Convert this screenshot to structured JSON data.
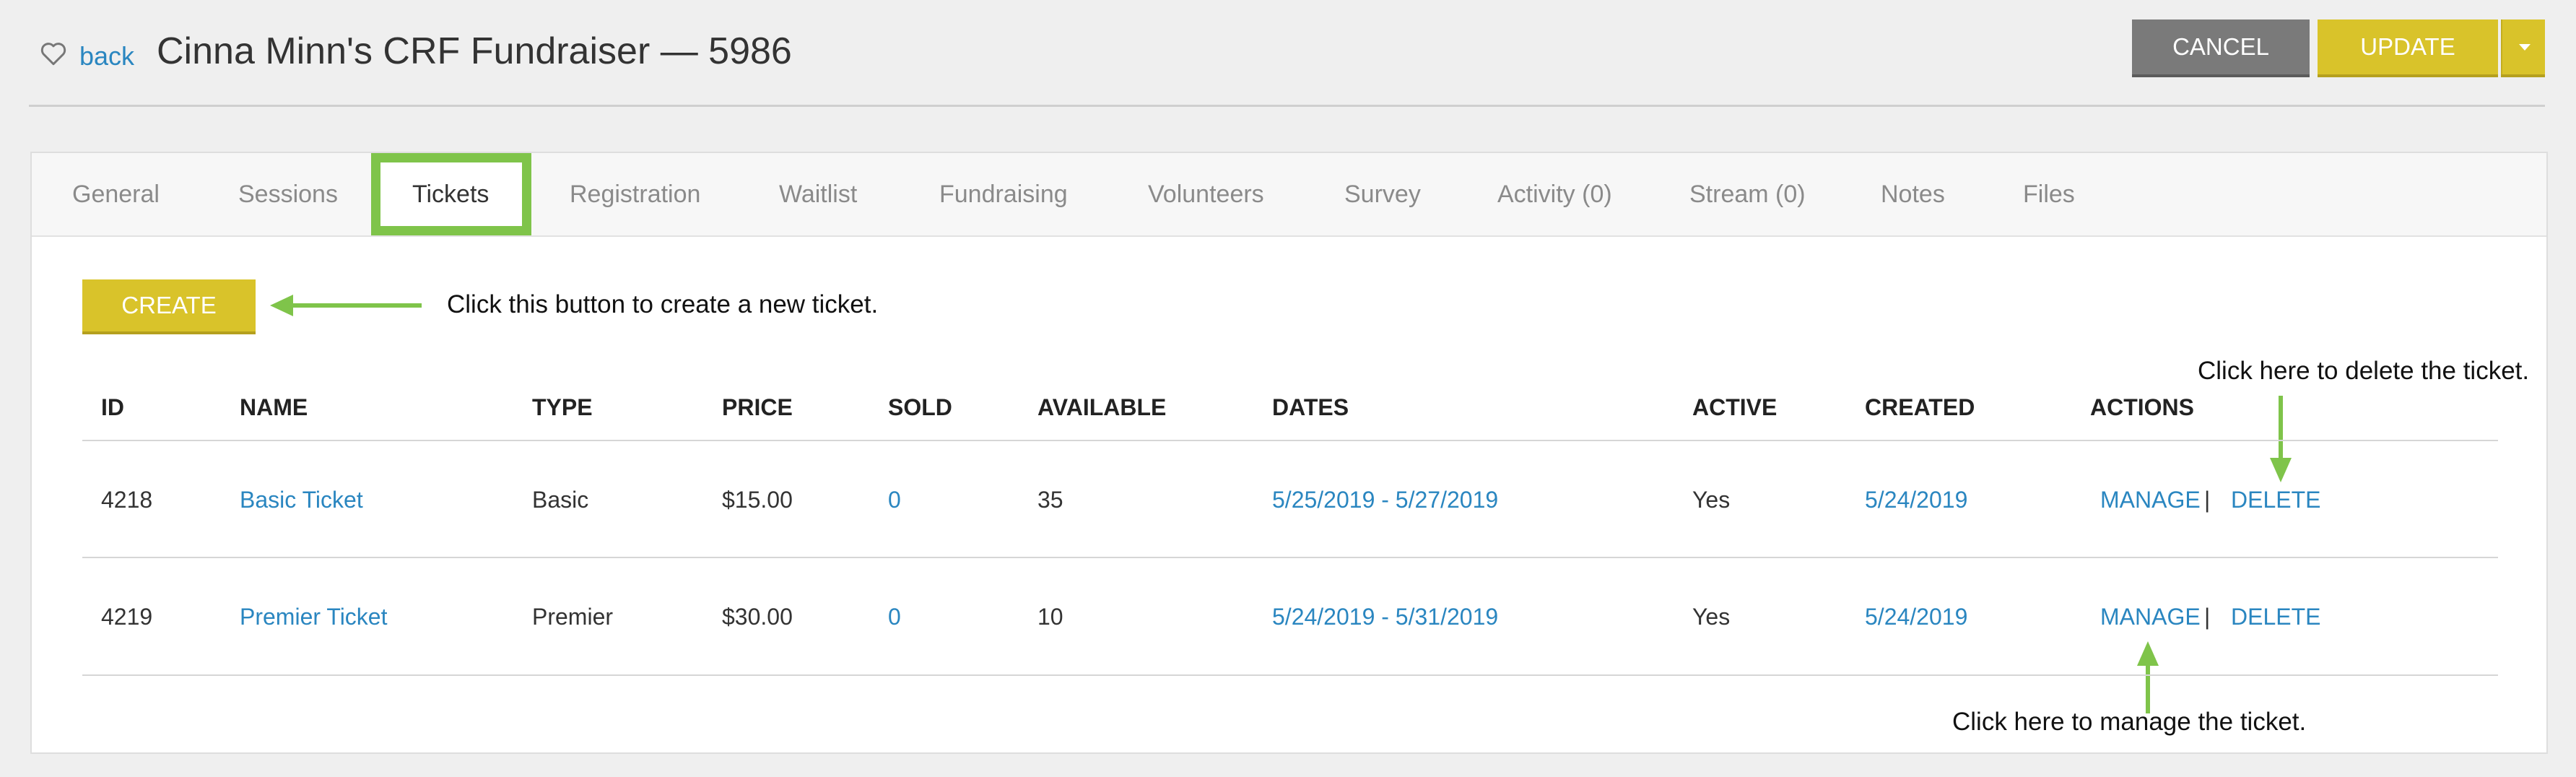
{
  "header": {
    "back_label": "back",
    "title": "Cinna Minn's CRF Fundraiser — 5986",
    "cancel_label": "CANCEL",
    "update_label": "UPDATE"
  },
  "tabs": [
    {
      "label": "General"
    },
    {
      "label": "Sessions"
    },
    {
      "label": "Tickets",
      "active": true
    },
    {
      "label": "Registration"
    },
    {
      "label": "Waitlist"
    },
    {
      "label": "Fundraising"
    },
    {
      "label": "Volunteers"
    },
    {
      "label": "Survey"
    },
    {
      "label": "Activity (0)"
    },
    {
      "label": "Stream (0)"
    },
    {
      "label": "Notes"
    },
    {
      "label": "Files"
    }
  ],
  "create_label": "CREATE",
  "annotations": {
    "create": "Click this button to create a new ticket.",
    "delete": "Click here to delete the ticket.",
    "manage": "Click here to manage the ticket."
  },
  "table": {
    "columns": [
      "ID",
      "NAME",
      "TYPE",
      "PRICE",
      "SOLD",
      "AVAILABLE",
      "DATES",
      "ACTIVE",
      "CREATED",
      "ACTIONS"
    ],
    "rows": [
      {
        "id": "4218",
        "name": "Basic Ticket",
        "type": "Basic",
        "price": "$15.00",
        "sold": "0",
        "available": "35",
        "dates": "5/25/2019 - 5/27/2019",
        "active": "Yes",
        "created": "5/24/2019",
        "manage": "MANAGE",
        "sep": "|",
        "delete": "DELETE"
      },
      {
        "id": "4219",
        "name": "Premier Ticket",
        "type": "Premier",
        "price": "$30.00",
        "sold": "0",
        "available": "10",
        "dates": "5/24/2019 - 5/31/2019",
        "active": "Yes",
        "created": "5/24/2019",
        "manage": "MANAGE",
        "sep": "|",
        "delete": "DELETE"
      }
    ]
  },
  "colors": {
    "accent_yellow": "#d9c32a",
    "cancel_gray": "#7a7a7a",
    "link_blue": "#2a86c0",
    "annotation_green": "#7fc44a"
  }
}
